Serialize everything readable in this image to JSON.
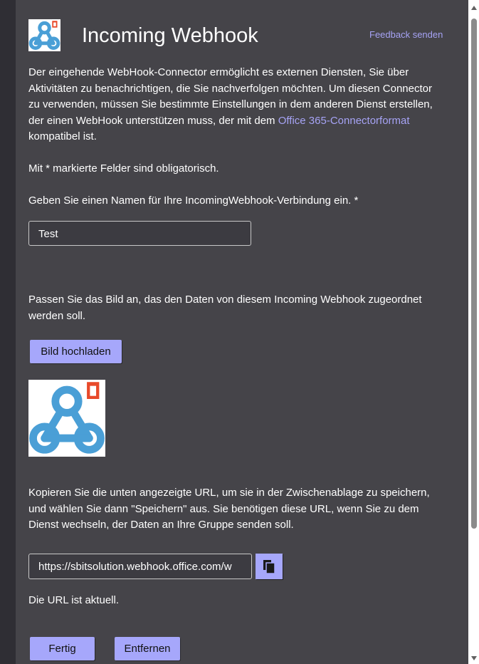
{
  "header": {
    "title": "Incoming Webhook",
    "feedback_link": "Feedback senden"
  },
  "intro": {
    "text_before_link": "Der eingehende WebHook-Connector ermöglicht es externen Diensten, Sie über Aktivitäten zu benachrichtigen, die Sie nachverfolgen möchten. Um diesen Connector zu verwenden, müssen Sie bestimmte Einstellungen in dem anderen Dienst erstellen, der einen WebHook unterstützen muss, der mit dem ",
    "link_text": "Office 365-Connectorformat",
    "text_after_link": " kompatibel ist."
  },
  "required_note": "Mit * markierte Felder sind obligatorisch.",
  "name_field": {
    "label": "Geben Sie einen Namen für Ihre IncomingWebhook-Verbindung ein. *",
    "value": "Test"
  },
  "image_section": {
    "label": "Passen Sie das Bild an, das den Daten von diesem Incoming Webhook zugeordnet werden soll.",
    "upload_button": "Bild hochladen"
  },
  "url_section": {
    "label": "Kopieren Sie die unten angezeigte URL, um sie in der Zwischenablage zu speichern, und wählen Sie dann \"Speichern\" aus. Sie benötigen diese URL, wenn Sie zu dem Dienst wechseln, der Daten an Ihre Gruppe senden soll.",
    "url_value": "https://sbitsolution.webhook.office.com/w",
    "status": "Die URL ist aktuell."
  },
  "footer": {
    "done_button": "Fertig",
    "remove_button": "Entfernen"
  },
  "icons": {
    "logo": "webhook-logo-icon",
    "copy": "copy-icon"
  },
  "colors": {
    "accent": "#a6a7fb",
    "link": "#a6a3f5",
    "dialog_bg": "#454449"
  }
}
